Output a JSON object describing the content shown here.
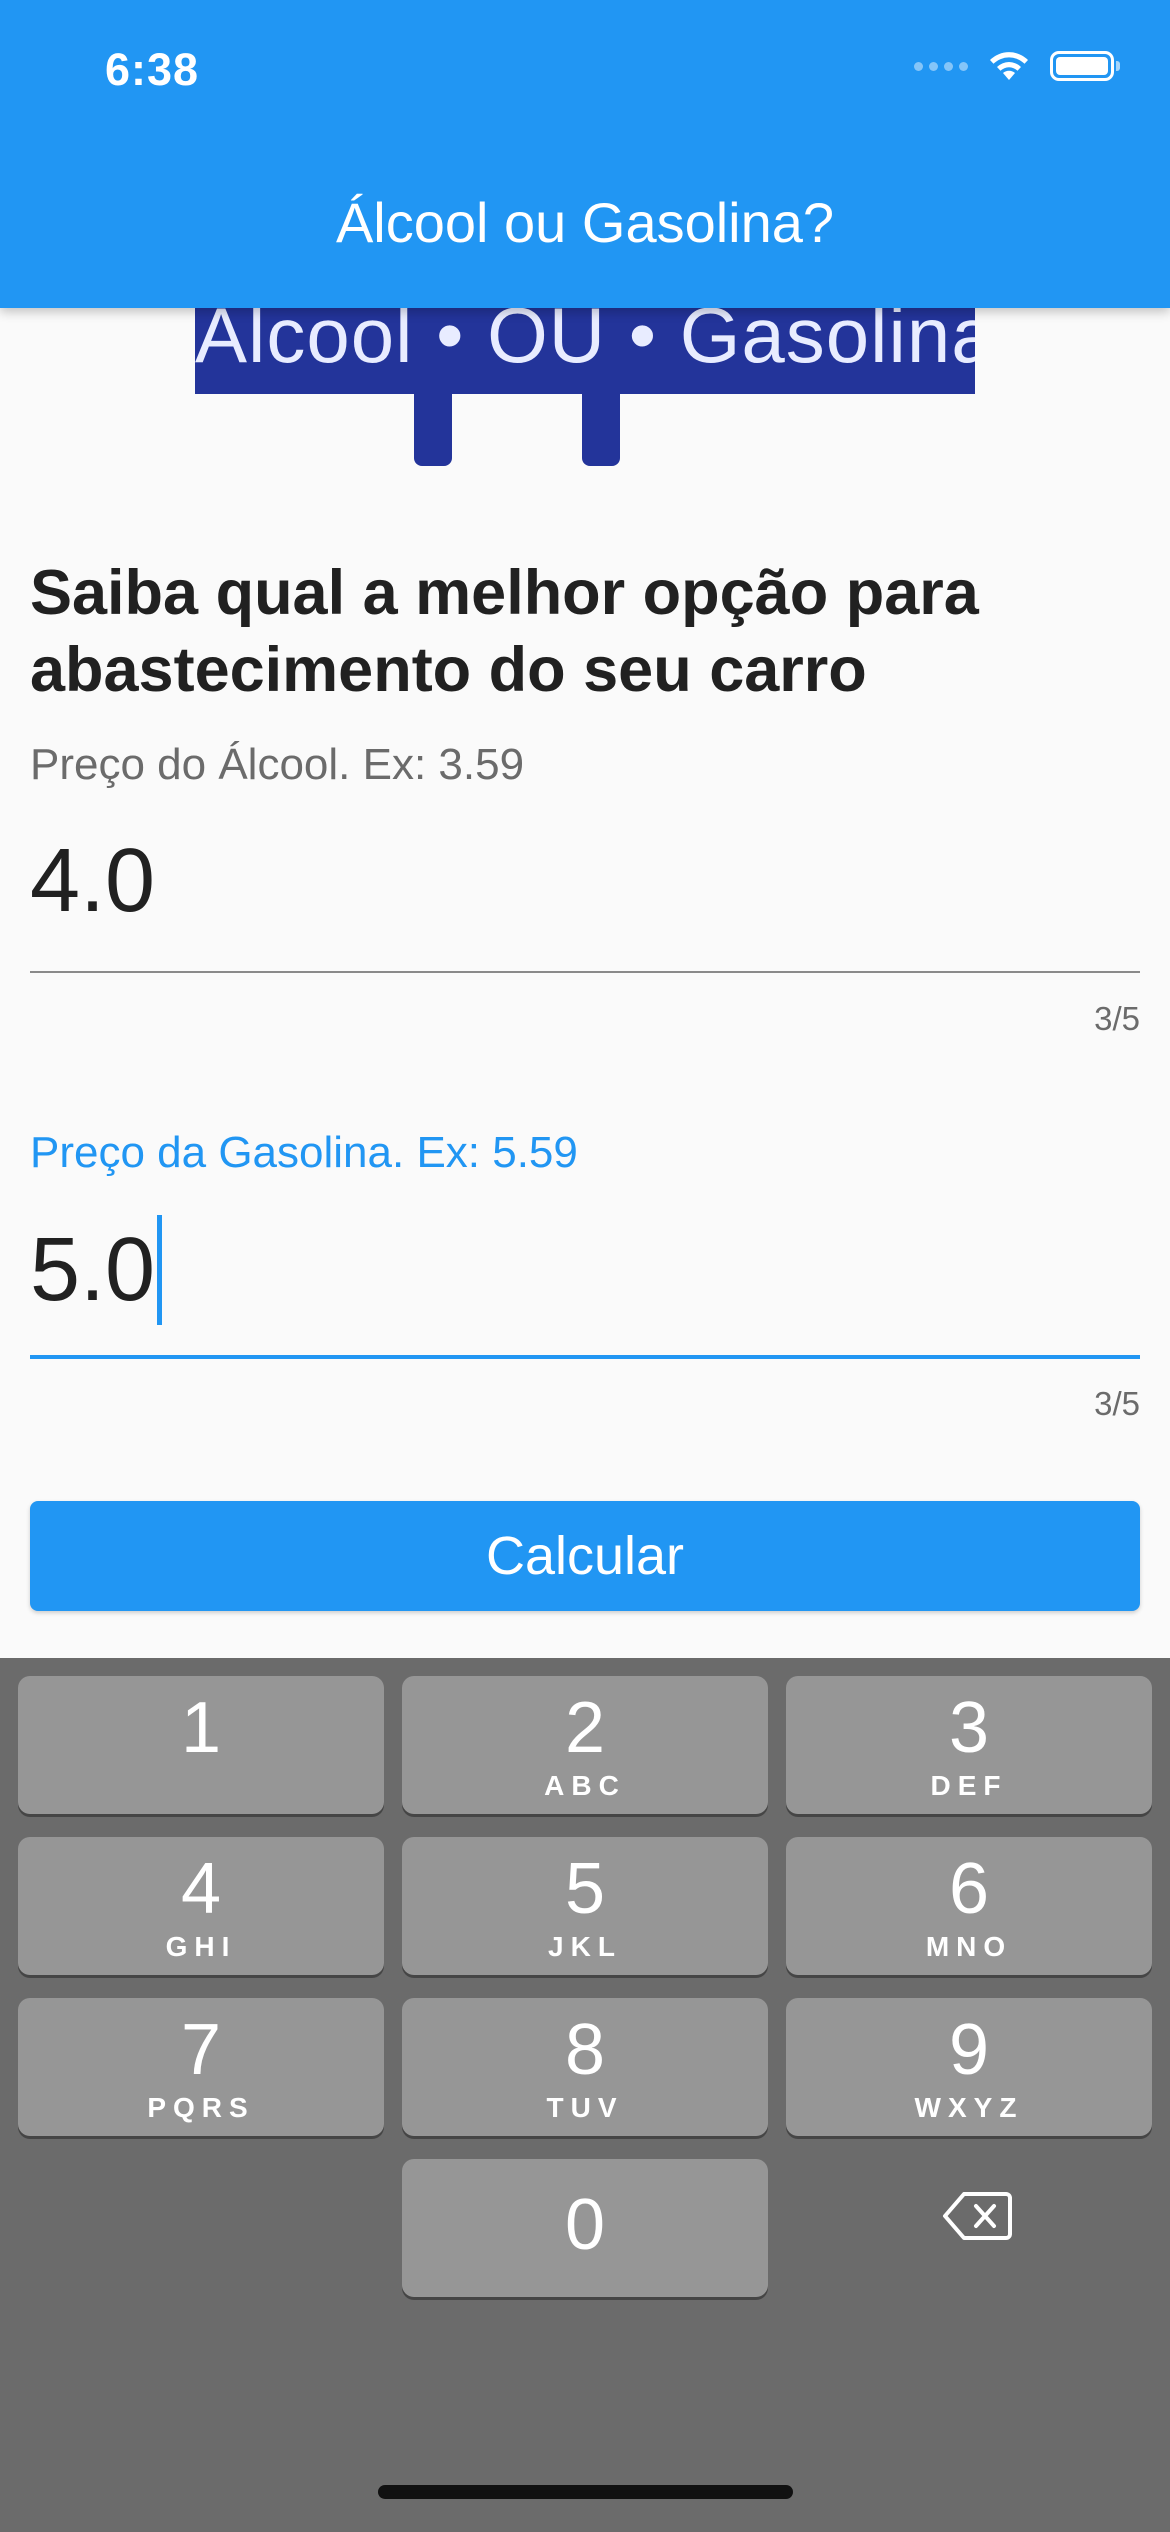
{
  "status_bar": {
    "time": "6:38"
  },
  "app_bar": {
    "title": "Álcool ou Gasolina?"
  },
  "logo": {
    "text": "Álcool • OU • Gasolina",
    "color": "#23349a"
  },
  "form": {
    "headline": "Saiba qual a melhor opção para abastecimento do seu carro",
    "alcool": {
      "label": "Preço do Álcool. Ex: 3.59",
      "value": "4.0",
      "counter": "3/5"
    },
    "gasolina": {
      "label": "Preço da Gasolina. Ex: 5.59",
      "value": "5.0",
      "counter": "3/5",
      "focused": true
    },
    "button_label": "Calcular"
  },
  "keyboard": {
    "keys": [
      {
        "digit": "1",
        "letters": ""
      },
      {
        "digit": "2",
        "letters": "ABC"
      },
      {
        "digit": "3",
        "letters": "DEF"
      },
      {
        "digit": "4",
        "letters": "GHI"
      },
      {
        "digit": "5",
        "letters": "JKL"
      },
      {
        "digit": "6",
        "letters": "MNO"
      },
      {
        "digit": "7",
        "letters": "PQRS"
      },
      {
        "digit": "8",
        "letters": "TUV"
      },
      {
        "digit": "9",
        "letters": "WXYZ"
      },
      {
        "digit": "0",
        "letters": ""
      }
    ],
    "delete_icon": "backspace-icon"
  },
  "colors": {
    "primary": "#2196f3",
    "keyboard_bg": "#6b6b6b",
    "key_bg": "#969696"
  }
}
